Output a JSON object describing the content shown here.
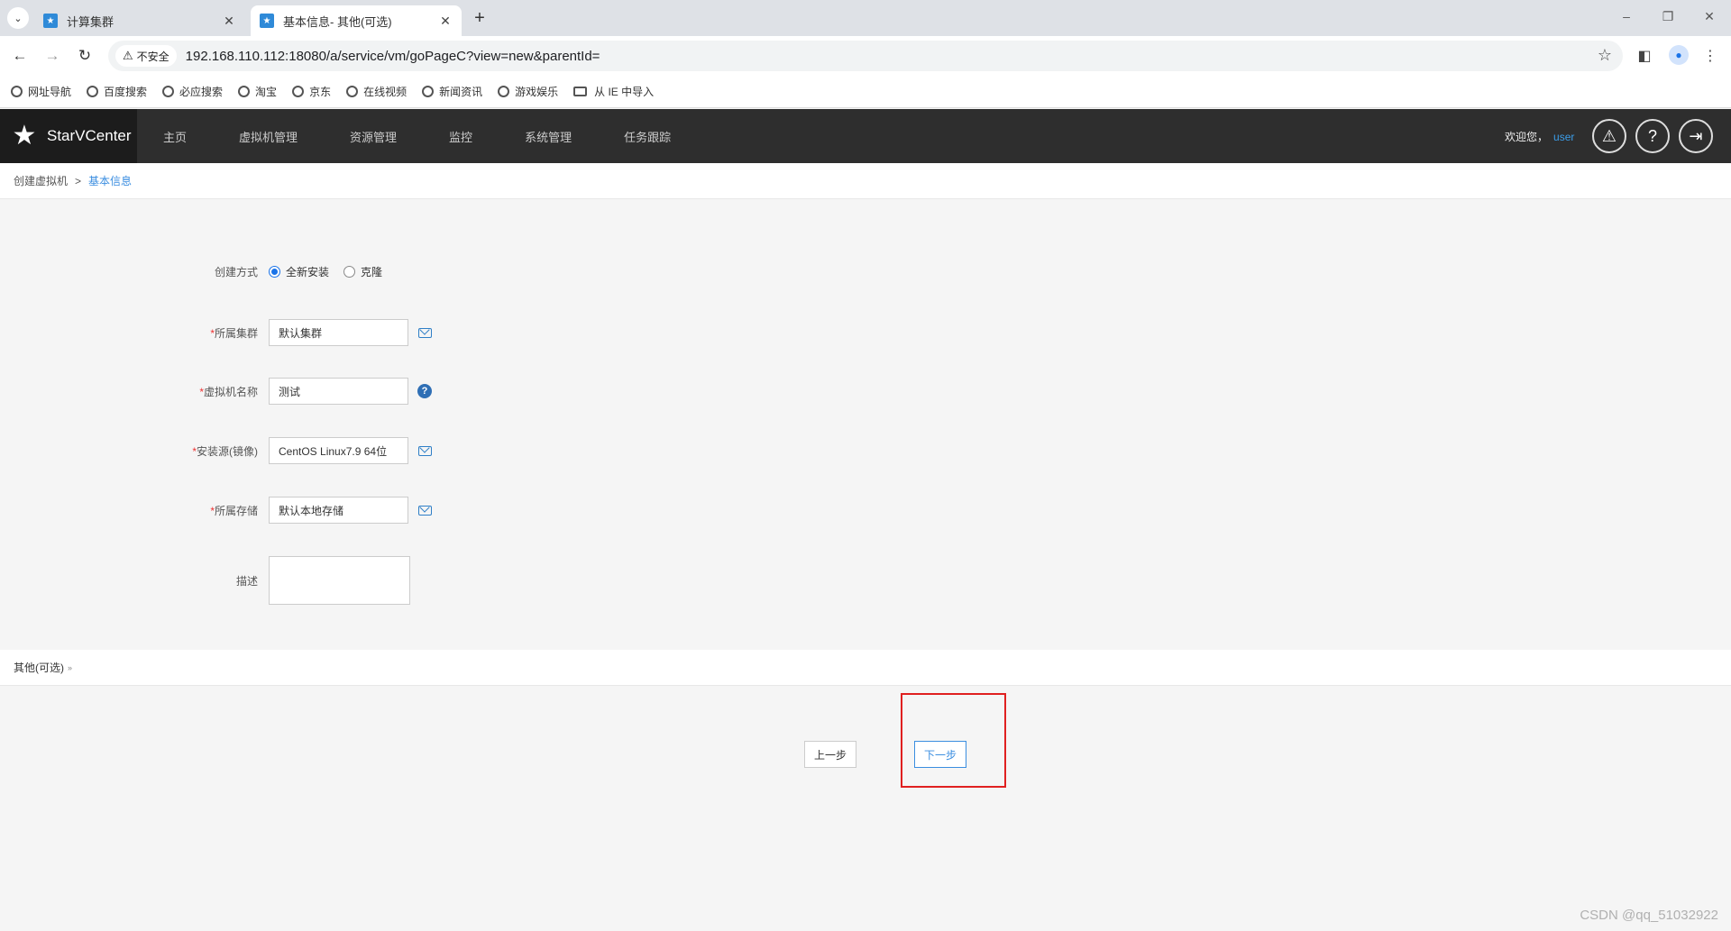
{
  "browser": {
    "tabs": [
      {
        "title": "计算集群",
        "favicon": "starvcenter-favicon",
        "active": false
      },
      {
        "title": "基本信息- 其他(可选)",
        "favicon": "starvcenter-favicon",
        "active": true
      }
    ],
    "security_label": "不安全",
    "url": "192.168.110.112:18080/a/service/vm/goPageC?view=new&parentId=",
    "bookmarks": [
      "网址导航",
      "百度搜索",
      "必应搜索",
      "淘宝",
      "京东",
      "在线视频",
      "新闻资讯",
      "游戏娱乐",
      "从 IE 中导入"
    ]
  },
  "header": {
    "logo_text": "StarVCenter",
    "nav": [
      "主页",
      "虚拟机管理",
      "资源管理",
      "监控",
      "系统管理",
      "任务跟踪"
    ],
    "welcome": "欢迎您，",
    "username": "user",
    "icons": [
      "alert-icon",
      "help-icon",
      "logout-icon"
    ]
  },
  "breadcrumb": {
    "parent": "创建虚拟机",
    "separator": ">",
    "current": "基本信息"
  },
  "form": {
    "create_method": {
      "label": "创建方式",
      "options": [
        "全新安装",
        "克隆"
      ],
      "selected": "全新安装"
    },
    "cluster": {
      "required": "*",
      "label": "所属集群",
      "value": "默认集群"
    },
    "vm_name": {
      "required": "*",
      "label": "虚拟机名称",
      "value": "测试"
    },
    "install_source": {
      "required": "*",
      "label": "安装源(镜像)",
      "value": "CentOS Linux7.9 64位"
    },
    "storage": {
      "required": "*",
      "label": "所属存储",
      "value": "默认本地存储"
    },
    "description": {
      "label": "描述",
      "value": ""
    }
  },
  "other_section": {
    "label": "其他(可选)",
    "chevron": "»"
  },
  "buttons": {
    "prev": "上一步",
    "next": "下一步"
  },
  "annotation": {
    "color": "#e02020"
  },
  "watermark": "CSDN @qq_51032922",
  "colors": {
    "accent": "#3b8ee0",
    "header_bg": "#2e2e2e",
    "required": "#e33"
  }
}
